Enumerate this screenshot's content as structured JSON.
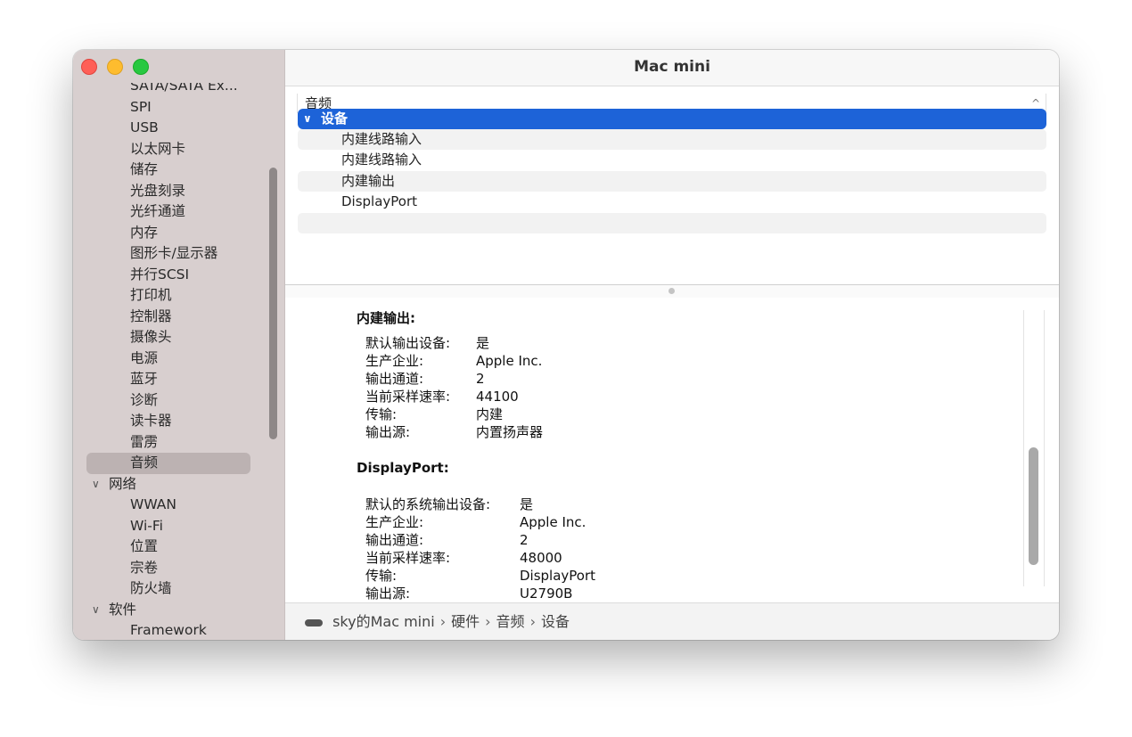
{
  "window": {
    "title": "Mac mini"
  },
  "sidebar": {
    "items": [
      {
        "label": "SATA/SATA Ex...",
        "type": "item"
      },
      {
        "label": "SPI",
        "type": "item"
      },
      {
        "label": "USB",
        "type": "item"
      },
      {
        "label": "以太网卡",
        "type": "item"
      },
      {
        "label": "储存",
        "type": "item"
      },
      {
        "label": "光盘刻录",
        "type": "item"
      },
      {
        "label": "光纤通道",
        "type": "item"
      },
      {
        "label": "内存",
        "type": "item"
      },
      {
        "label": "图形卡/显示器",
        "type": "item"
      },
      {
        "label": "并行SCSI",
        "type": "item"
      },
      {
        "label": "打印机",
        "type": "item"
      },
      {
        "label": "控制器",
        "type": "item"
      },
      {
        "label": "摄像头",
        "type": "item"
      },
      {
        "label": "电源",
        "type": "item"
      },
      {
        "label": "蓝牙",
        "type": "item"
      },
      {
        "label": "诊断",
        "type": "item"
      },
      {
        "label": "读卡器",
        "type": "item"
      },
      {
        "label": "雷雳",
        "type": "item"
      },
      {
        "label": "音频",
        "type": "selected"
      },
      {
        "label": "网络",
        "type": "group"
      },
      {
        "label": "WWAN",
        "type": "item"
      },
      {
        "label": "Wi-Fi",
        "type": "item"
      },
      {
        "label": "位置",
        "type": "item"
      },
      {
        "label": "宗卷",
        "type": "item"
      },
      {
        "label": "防火墙",
        "type": "item"
      },
      {
        "label": "软件",
        "type": "group"
      },
      {
        "label": "Framework",
        "type": "item"
      }
    ]
  },
  "upper": {
    "section_title": "音频",
    "rows": [
      {
        "label": "设备",
        "state": "selected"
      },
      {
        "label": "内建线路输入",
        "state": "alt"
      },
      {
        "label": "内建线路输入",
        "state": "normal"
      },
      {
        "label": "内建输出",
        "state": "alt"
      },
      {
        "label": "DisplayPort",
        "state": "normal"
      },
      {
        "label": "",
        "state": "alt"
      }
    ]
  },
  "detail": {
    "blocks": [
      {
        "title": "内建输出:",
        "fields": [
          {
            "key": "默认输出设备:",
            "value": "是"
          },
          {
            "key": "生产企业:",
            "value": "Apple Inc."
          },
          {
            "key": "输出通道:",
            "value": "2"
          },
          {
            "key": "当前采样速率:",
            "value": "44100"
          },
          {
            "key": "传输:",
            "value": "内建"
          },
          {
            "key": "输出源:",
            "value": "内置扬声器"
          }
        ]
      },
      {
        "title": "DisplayPort:",
        "fields": [
          {
            "key": "默认的系统输出设备:",
            "value": "是"
          },
          {
            "key": "生产企业:",
            "value": "Apple Inc."
          },
          {
            "key": "输出通道:",
            "value": "2"
          },
          {
            "key": "当前采样速率:",
            "value": "48000"
          },
          {
            "key": "传输:",
            "value": "DisplayPort"
          },
          {
            "key": "输出源:",
            "value": "U2790B"
          }
        ]
      }
    ]
  },
  "statusbar": {
    "crumbs": [
      "sky的Mac mini",
      "硬件",
      "音频",
      "设备"
    ],
    "separator": "›"
  },
  "icons": {
    "row_disclosure": "∨",
    "section_collapse": "^",
    "group_disclosure": "∨"
  }
}
